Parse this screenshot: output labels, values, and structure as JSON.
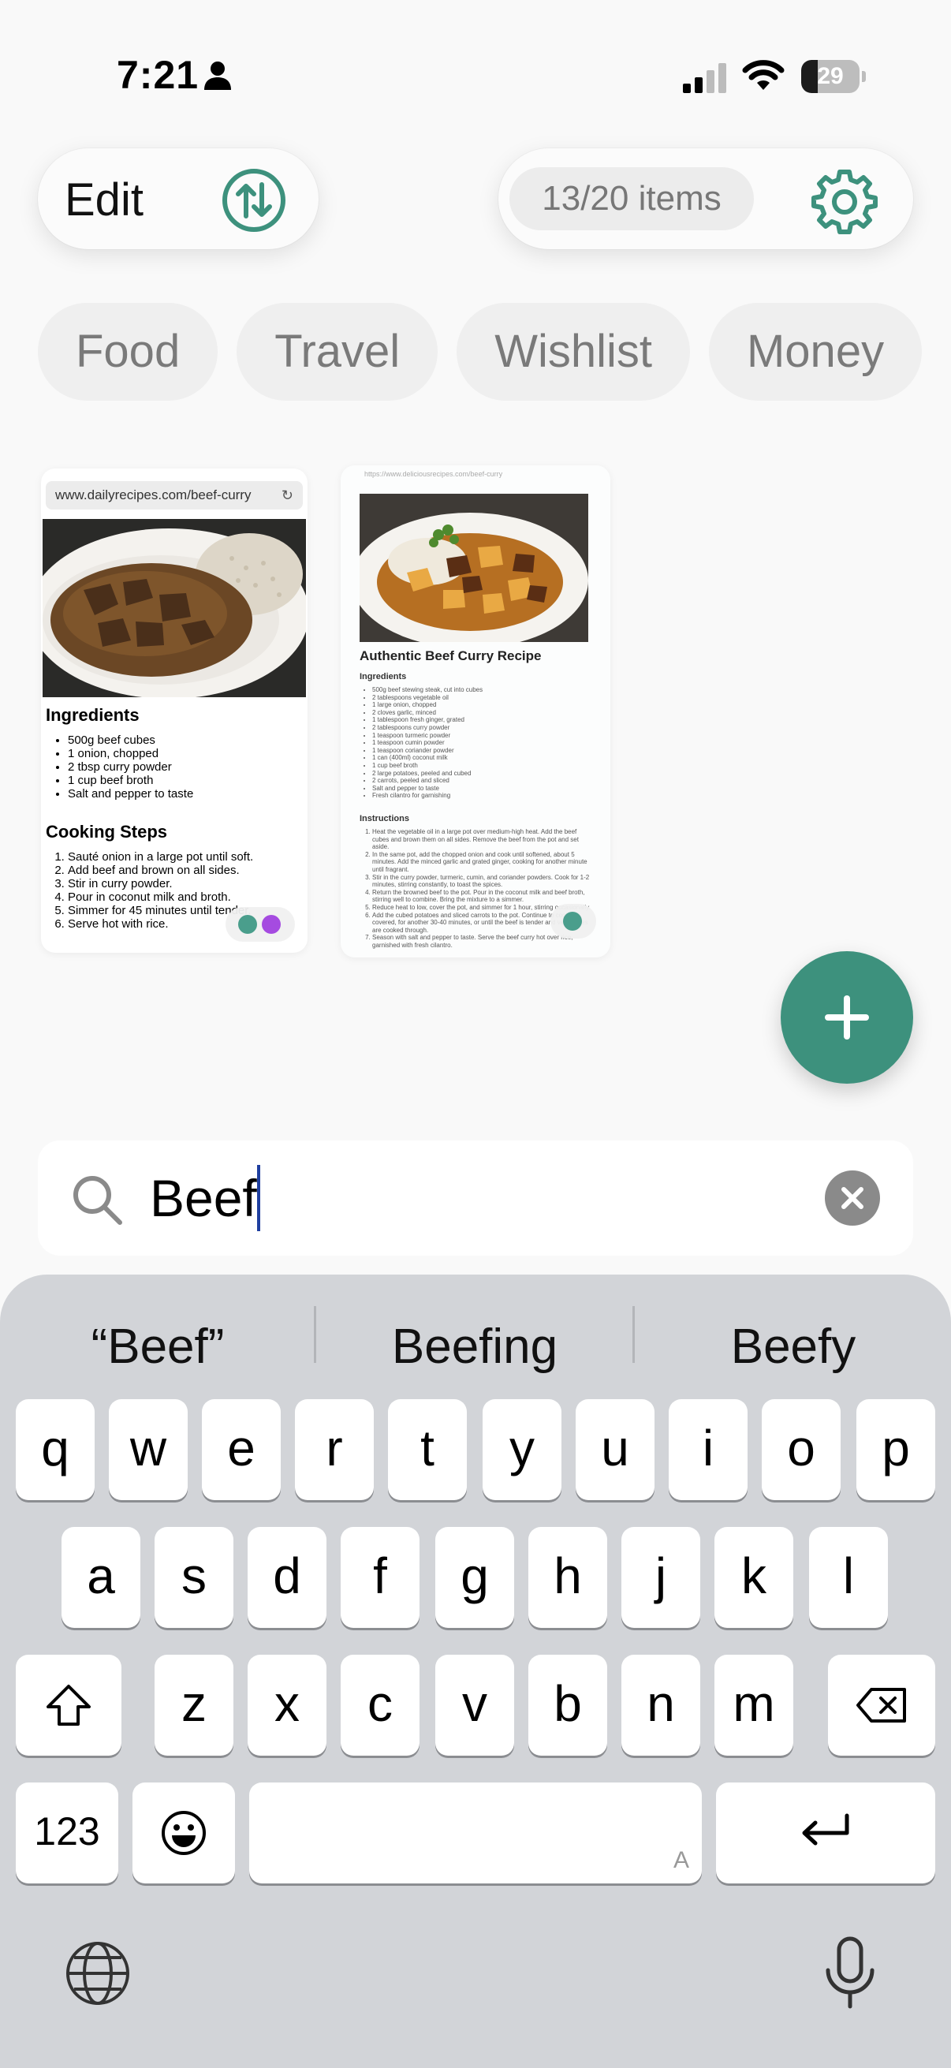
{
  "status_bar": {
    "time": "7:21",
    "battery_level": "29",
    "battery_fraction": 0.29
  },
  "header": {
    "edit_label": "Edit",
    "items_count": "13/20 items"
  },
  "chips": [
    "Food",
    "Travel",
    "Wishlist",
    "Money"
  ],
  "cards": [
    {
      "url": "www.dailyrecipes.com/beef-curry",
      "ingredients_heading": "Ingredients",
      "ingredients": [
        "500g beef cubes",
        "1 onion, chopped",
        "2 tbsp curry powder",
        "1 cup beef broth",
        "Salt and pepper to taste"
      ],
      "steps_heading": "Cooking Steps",
      "steps": [
        "Sauté onion in a large pot until soft.",
        "Add beef and brown on all sides.",
        "Stir in curry powder.",
        "Pour in coconut milk and broth.",
        "Simmer for 45 minutes until tender.",
        "Serve hot with rice."
      ],
      "tag_colors": [
        "#4a9e8c",
        "#a54be0"
      ]
    },
    {
      "url": "https://www.deliciousrecipes.com/beef-curry",
      "title": "Authentic Beef Curry Recipe",
      "ingredients_heading": "Ingredients",
      "ingredients": [
        "500g beef stewing steak, cut into cubes",
        "2 tablespoons vegetable oil",
        "1 large onion, chopped",
        "2 cloves garlic, minced",
        "1 tablespoon fresh ginger, grated",
        "2 tablespoons curry powder",
        "1 teaspoon turmeric powder",
        "1 teaspoon cumin powder",
        "1 teaspoon coriander powder",
        "1 can (400ml) coconut milk",
        "1 cup beef broth",
        "2 large potatoes, peeled and cubed",
        "2 carrots, peeled and sliced",
        "Salt and pepper to taste",
        "Fresh cilantro for garnishing"
      ],
      "instructions_heading": "Instructions",
      "instructions": [
        "Heat the vegetable oil in a large pot over medium-high heat. Add the beef cubes and brown them on all sides. Remove the beef from the pot and set aside.",
        "In the same pot, add the chopped onion and cook until softened, about 5 minutes. Add the minced garlic and grated ginger, cooking for another minute until fragrant.",
        "Stir in the curry powder, turmeric, cumin, and coriander powders. Cook for 1-2 minutes, stirring constantly, to toast the spices.",
        "Return the browned beef to the pot. Pour in the coconut milk and beef broth, stirring well to combine. Bring the mixture to a simmer.",
        "Reduce heat to low, cover the pot, and simmer for 1 hour, stirring occasionally.",
        "Add the cubed potatoes and sliced carrots to the pot. Continue to cook, covered, for another 30-40 minutes, or until the beef is tender and vegetables are cooked through.",
        "Season with salt and pepper to taste. Serve the beef curry hot over rice, garnished with fresh cilantro."
      ],
      "tag_colors": [
        "#4a9e8c"
      ]
    }
  ],
  "search": {
    "value": "Beef"
  },
  "keyboard": {
    "suggestions": [
      "“Beef”",
      "Beefing",
      "Beefy"
    ],
    "row1": [
      "q",
      "w",
      "e",
      "r",
      "t",
      "y",
      "u",
      "i",
      "o",
      "p"
    ],
    "row2": [
      "a",
      "s",
      "d",
      "f",
      "g",
      "h",
      "j",
      "k",
      "l"
    ],
    "row3": [
      "z",
      "x",
      "c",
      "v",
      "b",
      "n",
      "m"
    ],
    "numbers_label": "123",
    "space_hint": "A"
  },
  "colors": {
    "accent": "#3d917d",
    "chip_text": "#7a7a7a",
    "keyboard_bg": "#d2d4d8"
  }
}
